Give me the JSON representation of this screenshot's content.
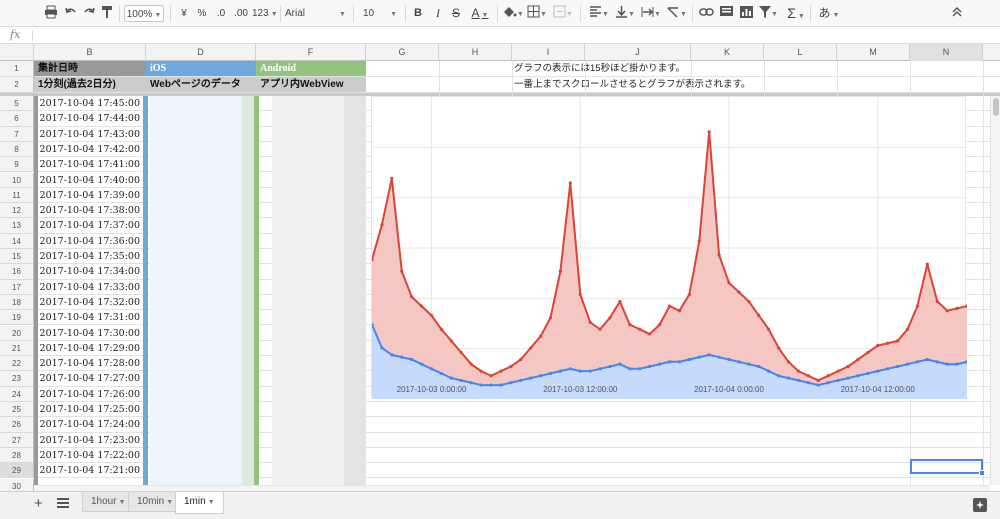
{
  "toolbar": {
    "zoom": "100%",
    "currency": "¥",
    "percent": "%",
    "dec_decrease": ".0",
    "dec_increase": ".00",
    "format_more": "123",
    "font": "Arial",
    "font_size": "10",
    "bold": "B",
    "italic": "I",
    "strike": "S",
    "text_color": "A",
    "input_tool": "あ"
  },
  "formula_bar": {
    "fx_label": "fx",
    "value": ""
  },
  "columns": [
    "B",
    "D",
    "F",
    "G",
    "H",
    "I",
    "J",
    "K",
    "L",
    "M",
    "N"
  ],
  "header_rows": {
    "row1": {
      "b": "集計日時",
      "d": "iOS",
      "f": "Android",
      "note": "グラフの表示には15秒ほど掛かります。"
    },
    "row2": {
      "b": "1分刻(過去2日分)",
      "d": "Webページのデータ",
      "f": "アプリ内WebView",
      "note": "一番上までスクロールさせるとグラフが表示されます。"
    }
  },
  "row_numbers": [
    "1",
    "2",
    "5",
    "6",
    "7",
    "8",
    "9",
    "10",
    "11",
    "12",
    "13",
    "14",
    "15",
    "16",
    "17",
    "18",
    "19",
    "20",
    "21",
    "22",
    "23",
    "24",
    "25",
    "26",
    "27",
    "28",
    "29",
    "30"
  ],
  "dates": [
    "2017-10-04 17:45:00",
    "2017-10-04 17:44:00",
    "2017-10-04 17:43:00",
    "2017-10-04 17:42:00",
    "2017-10-04 17:41:00",
    "2017-10-04 17:40:00",
    "2017-10-04 17:39:00",
    "2017-10-04 17:38:00",
    "2017-10-04 17:37:00",
    "2017-10-04 17:36:00",
    "2017-10-04 17:35:00",
    "2017-10-04 17:34:00",
    "2017-10-04 17:33:00",
    "2017-10-04 17:32:00",
    "2017-10-04 17:31:00",
    "2017-10-04 17:30:00",
    "2017-10-04 17:29:00",
    "2017-10-04 17:28:00",
    "2017-10-04 17:27:00",
    "2017-10-04 17:26:00",
    "2017-10-04 17:25:00",
    "2017-10-04 17:24:00",
    "2017-10-04 17:23:00",
    "2017-10-04 17:22:00",
    "2017-10-04 17:21:00",
    ""
  ],
  "colors": {
    "ios_header": "#6fa8dc",
    "android_header": "#93c47d",
    "b_header": "#999999",
    "series_red": "#db4437",
    "series_blue": "#4285f4"
  },
  "chart_data": {
    "type": "area",
    "x_tick_labels": [
      "2017-10-03 0:00:00",
      "2017-10-03 12:00:00",
      "2017-10-04 0:00:00",
      "2017-10-04 12:00:00"
    ],
    "series": [
      {
        "name": "",
        "color": "#db4437"
      },
      {
        "name": "",
        "color": "#4285f4"
      }
    ],
    "x": [
      0,
      1,
      2,
      3,
      4,
      5,
      6,
      7,
      8,
      9,
      10,
      11,
      12,
      13,
      14,
      15,
      16,
      17,
      18,
      19,
      20,
      21,
      22,
      23,
      24,
      25,
      26,
      27,
      28,
      29,
      30,
      31,
      32,
      33,
      34,
      35,
      36,
      37,
      38,
      39,
      40,
      41,
      42,
      43,
      44,
      45,
      46,
      47,
      48,
      49,
      50,
      51,
      52,
      53,
      54,
      55,
      56,
      57,
      58,
      59,
      60
    ],
    "red": [
      60,
      75,
      95,
      55,
      44,
      40,
      36,
      30,
      25,
      20,
      15,
      12,
      10,
      12,
      14,
      17,
      22,
      27,
      35,
      55,
      93,
      45,
      33,
      30,
      35,
      42,
      32,
      30,
      28,
      32,
      40,
      38,
      45,
      68,
      115,
      62,
      50,
      46,
      42,
      36,
      30,
      22,
      16,
      12,
      10,
      8,
      10,
      12,
      14,
      17,
      20,
      23,
      24,
      25,
      30,
      40,
      58,
      42,
      38,
      39,
      40
    ],
    "blue": [
      32,
      22,
      19,
      18,
      17,
      15,
      13,
      11,
      9,
      8,
      7,
      6,
      6,
      6,
      7,
      8,
      9,
      10,
      11,
      12,
      13,
      12,
      12,
      13,
      14,
      15,
      13,
      13,
      14,
      15,
      16,
      16,
      17,
      18,
      19,
      18,
      17,
      16,
      15,
      14,
      12,
      10,
      9,
      8,
      7,
      6,
      7,
      8,
      9,
      10,
      11,
      12,
      13,
      14,
      15,
      16,
      17,
      16,
      15,
      15,
      16
    ]
  },
  "sheets": [
    {
      "label": "1hour",
      "active": false
    },
    {
      "label": "10min",
      "active": false
    },
    {
      "label": "1min",
      "active": true
    }
  ]
}
